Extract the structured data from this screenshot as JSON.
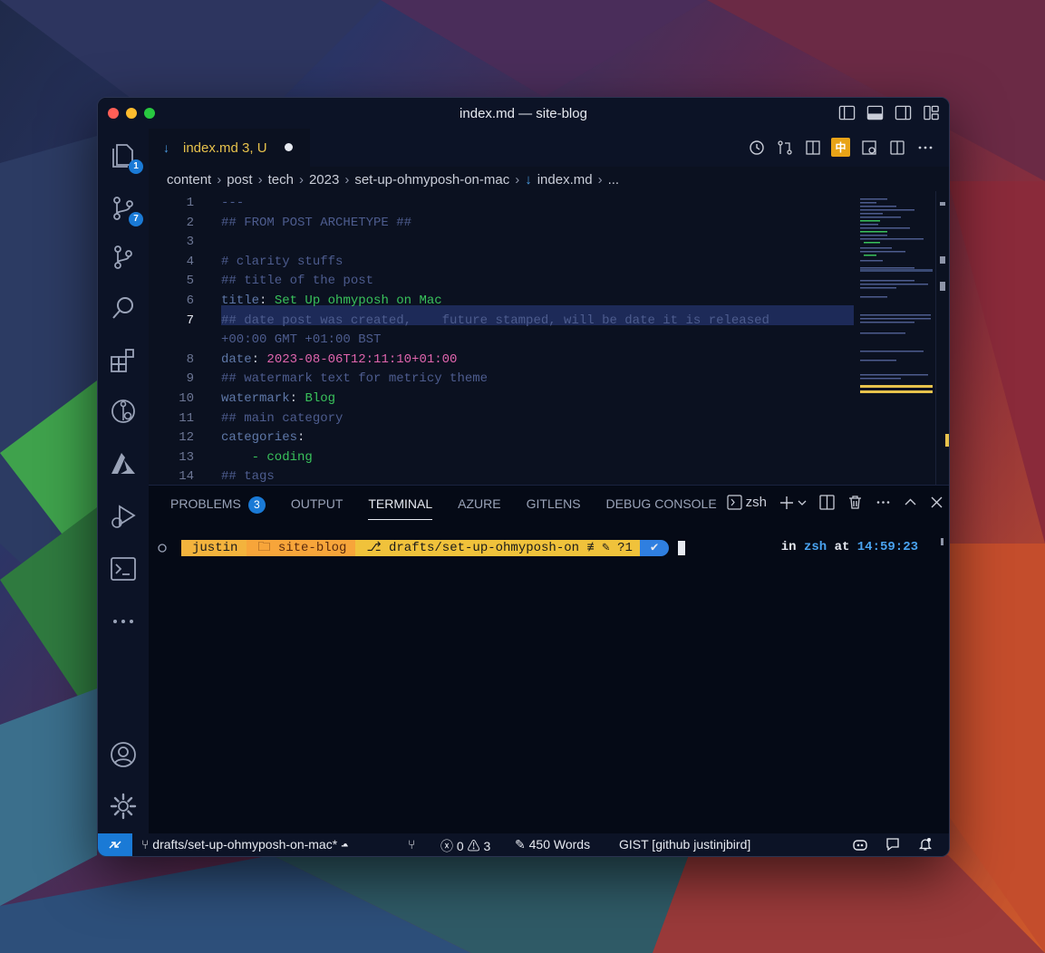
{
  "window": {
    "title": "index.md — site-blog"
  },
  "activity_bar": {
    "explorer_badge": "1",
    "source_control_badge": "7"
  },
  "tab": {
    "icon": "↓",
    "name": "index.md",
    "status": "3, U"
  },
  "breadcrumb": [
    "content",
    "post",
    "tech",
    "2023",
    "set-up-ohmyposh-on-mac",
    "index.md",
    "..."
  ],
  "editor": {
    "lines": [
      {
        "n": "1",
        "text": "---"
      },
      {
        "n": "2",
        "text": "## FROM POST ARCHETYPE ##"
      },
      {
        "n": "3",
        "text": ""
      },
      {
        "n": "4",
        "text": "# clarity stuffs"
      },
      {
        "n": "5",
        "text": "## title of the post"
      },
      {
        "n": "6",
        "key": "title",
        "value": "Set Up ohmyposh on Mac"
      },
      {
        "n": "7",
        "text": "## date post was created,    future stamped, will be date it is released"
      },
      {
        "n": "",
        "text": "+00:00 GMT +01:00 BST"
      },
      {
        "n": "8",
        "key": "date",
        "value": "2023-08-06T12:11:10+01:00"
      },
      {
        "n": "9",
        "text": "## watermark text for metricy theme"
      },
      {
        "n": "10",
        "key": "watermark",
        "value": "Blog"
      },
      {
        "n": "11",
        "text": "## main category"
      },
      {
        "n": "12",
        "key": "categories",
        "value": ""
      },
      {
        "n": "13",
        "text": "    - coding"
      },
      {
        "n": "14",
        "text": "## tags"
      }
    ]
  },
  "panel": {
    "tabs": [
      "PROBLEMS",
      "OUTPUT",
      "TERMINAL",
      "AZURE",
      "GITLENS",
      "DEBUG CONSOLE"
    ],
    "problems_count": "3",
    "shell": "zsh"
  },
  "terminal": {
    "user": "justin",
    "folder": "site-blog",
    "branch": "drafts/set-up-ohmyposh-on",
    "git_status": "≢ ✎ ?1",
    "check": "✔",
    "right_in": "in",
    "right_shell": "zsh",
    "right_at": "at",
    "time": "14:59:23"
  },
  "statusbar": {
    "branch": "drafts/set-up-ohmyposh-on-mac*",
    "errors": "0",
    "warnings": "3",
    "words": "450 Words",
    "gist": "GIST [github justinjbird]"
  },
  "colors": {
    "accent": "#1a7ad6",
    "prompt_user": "#f3b33d",
    "prompt_folder": "#f7a53a",
    "prompt_branch": "#f0c23b",
    "prompt_check": "#2f7fe0"
  }
}
